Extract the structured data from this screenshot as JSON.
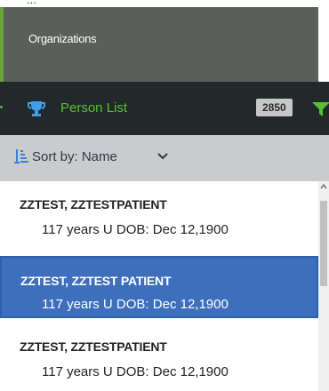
{
  "organizations_label": "Organizations",
  "person_list": {
    "title": "Person List",
    "count": "2850",
    "icon": "trophy-icon",
    "filter_icon": "filter-icon"
  },
  "sort": {
    "label": "Sort by: Name",
    "icon": "sort-icon",
    "dropdown_icon": "chevron-down-icon"
  },
  "patients": [
    {
      "name": "ZZTEST, ZZTESTPATIENT",
      "details": "117 years U DOB: Dec 12,1900",
      "selected": false
    },
    {
      "name": "ZZTEST, ZZTEST PATIENT",
      "details": "117 years U DOB: Dec 12,1900",
      "selected": true
    },
    {
      "name": "ZZTEST, ZZTESTPATIENT",
      "details": "117 years U DOB: Dec 12,1900",
      "selected": false
    }
  ],
  "colors": {
    "header_bg": "#5a5f5a",
    "person_bar_bg": "#23282a",
    "accent_green": "#56c232",
    "sort_bar_bg": "#c9cbcd",
    "selected_bg": "#3d6fbd",
    "selected_border": "#2c5fb1"
  }
}
